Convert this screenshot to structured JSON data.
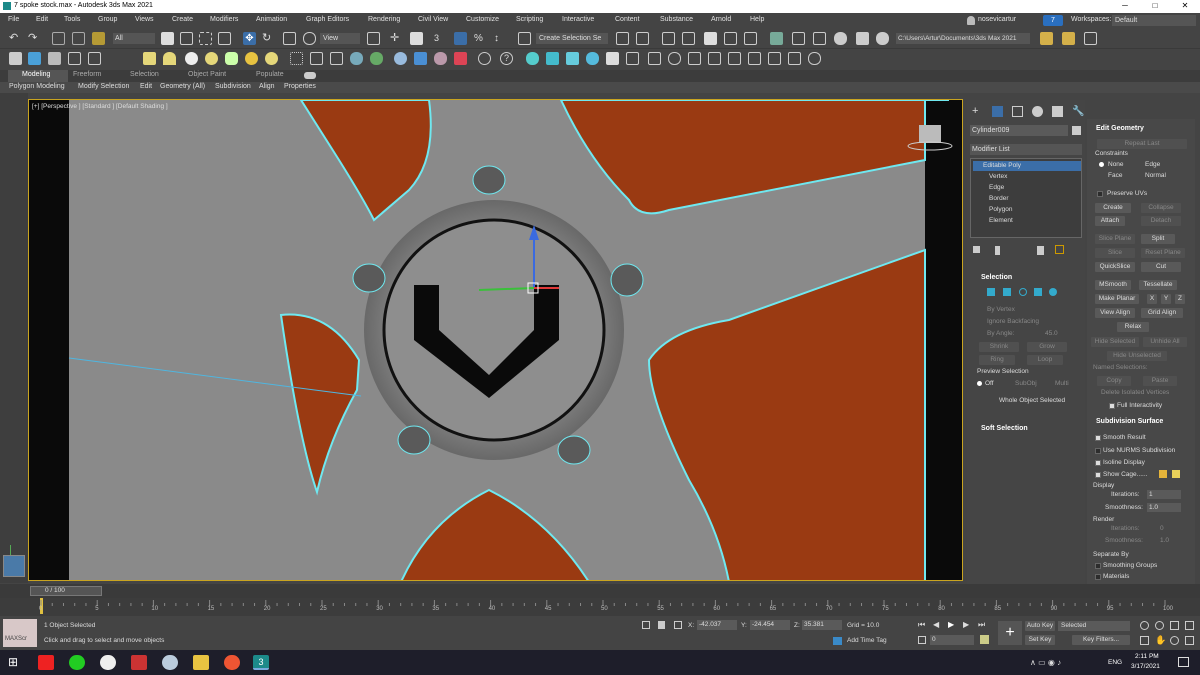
{
  "window": {
    "title": "7 spoke stock.max - Autodesk 3ds Max 2021",
    "controls": [
      "─",
      "□",
      "✕"
    ]
  },
  "menu": [
    "File",
    "Edit",
    "Tools",
    "Group",
    "Views",
    "Create",
    "Modifiers",
    "Animation",
    "Graph Editors",
    "Rendering",
    "Civil View",
    "Customize",
    "Scripting",
    "Interactive",
    "Content",
    "Substance",
    "Arnold",
    "Help"
  ],
  "account": {
    "user": "nosevicartur",
    "badge": "7",
    "workspace_label": "Workspaces:",
    "workspace_value": "Default"
  },
  "toolbar": {
    "filter": "All",
    "view": "View",
    "selection_set": "Create Selection Se",
    "project_path": "C:\\Users\\Artur\\Documents\\3ds Max 2021"
  },
  "ribbon": {
    "tabs": [
      "Modeling",
      "Freeform",
      "Selection",
      "Object Paint",
      "Populate"
    ],
    "subtabs": [
      "Polygon Modeling",
      "Modify Selection",
      "Edit",
      "Geometry (All)",
      "Subdivision",
      "Align",
      "Properties"
    ]
  },
  "viewport": {
    "label": "[+] [Perspective ] [Standard ] [Default Shading ]",
    "colors": {
      "panel": "#9a3a12",
      "surface": "#8a8a8a",
      "edge": "#6fe8f0"
    }
  },
  "command_panel": {
    "object_name": "Cylinder009",
    "modifier_list": "Modifier List",
    "stack": [
      "Editable Poly",
      "Vertex",
      "Edge",
      "Border",
      "Polygon",
      "Element"
    ],
    "selection": {
      "title": "Selection",
      "by_vertex": "By Vertex",
      "ignore_backfacing": "Ignore Backfacing",
      "by_angle": "By Angle:",
      "angle_value": "45.0",
      "shrink": "Shrink",
      "grow": "Grow",
      "ring": "Ring",
      "loop": "Loop",
      "preview_selection": "Preview Selection",
      "preview_options": [
        "Off",
        "SubObj",
        "Multi"
      ],
      "status": "Whole Object Selected"
    },
    "soft_selection": "Soft Selection"
  },
  "edit_geometry": {
    "title": "Edit Geometry",
    "repeat_last": "Repeat Last",
    "constraints": "Constraints",
    "constraint_options": [
      "None",
      "Edge",
      "Face",
      "Normal"
    ],
    "preserve_uvs": "Preserve UVs",
    "buttons": [
      "Create",
      "Collapse",
      "Attach",
      "Detach",
      "Slice Plane",
      "Split",
      "Slice",
      "Reset Plane",
      "QuickSlice",
      "Cut",
      "MSmooth",
      "Tessellate",
      "Make Planar",
      "X",
      "Y",
      "Z",
      "View Align",
      "Grid Align",
      "Relax",
      "Hide Selected",
      "Unhide All",
      "Hide Unselected"
    ],
    "named_selections": "Named Selections:",
    "copy": "Copy",
    "paste": "Paste",
    "delete_isolated": "Delete Isolated Vertices",
    "full_interactivity": "Full Interactivity"
  },
  "subdivision": {
    "title": "Subdivision Surface",
    "smooth_result": "Smooth Result",
    "use_nurms": "Use NURMS Subdivision",
    "isoline": "Isoline Display",
    "show_cage": "Show Cage......",
    "display": "Display",
    "iterations_label": "Iterations:",
    "iterations": "1",
    "smoothness_label": "Smoothness:",
    "smoothness": "1.0",
    "render": "Render",
    "r_iterations": "0",
    "r_smoothness": "1.0",
    "separate_by": "Separate By",
    "smoothing_groups": "Smoothing Groups",
    "materials": "Materials"
  },
  "timeline": {
    "frame": "0 / 100",
    "ticks": [
      "0",
      "5",
      "10",
      "15",
      "20",
      "25",
      "30",
      "35",
      "40",
      "45",
      "50",
      "55",
      "60",
      "65",
      "70",
      "75",
      "80",
      "85",
      "90",
      "95",
      "100"
    ]
  },
  "status": {
    "maxscript": "MAXScr",
    "selected": "1 Object Selected",
    "prompt": "Click and drag to select and move objects",
    "x_label": "X:",
    "x": "-42.037",
    "y_label": "Y:",
    "y": "-24.454",
    "z_label": "Z:",
    "z": "35.381",
    "grid": "Grid = 10.0",
    "add_time_tag": "Add Time Tag",
    "auto_key": "Auto Key",
    "set_key": "Set Key",
    "key_mode": "Selected",
    "key_filters": "Key Filters...",
    "frame_field": "0"
  },
  "taskbar": {
    "lang": "ENG",
    "time": "2:11 PM",
    "date": "3/17/2021"
  }
}
